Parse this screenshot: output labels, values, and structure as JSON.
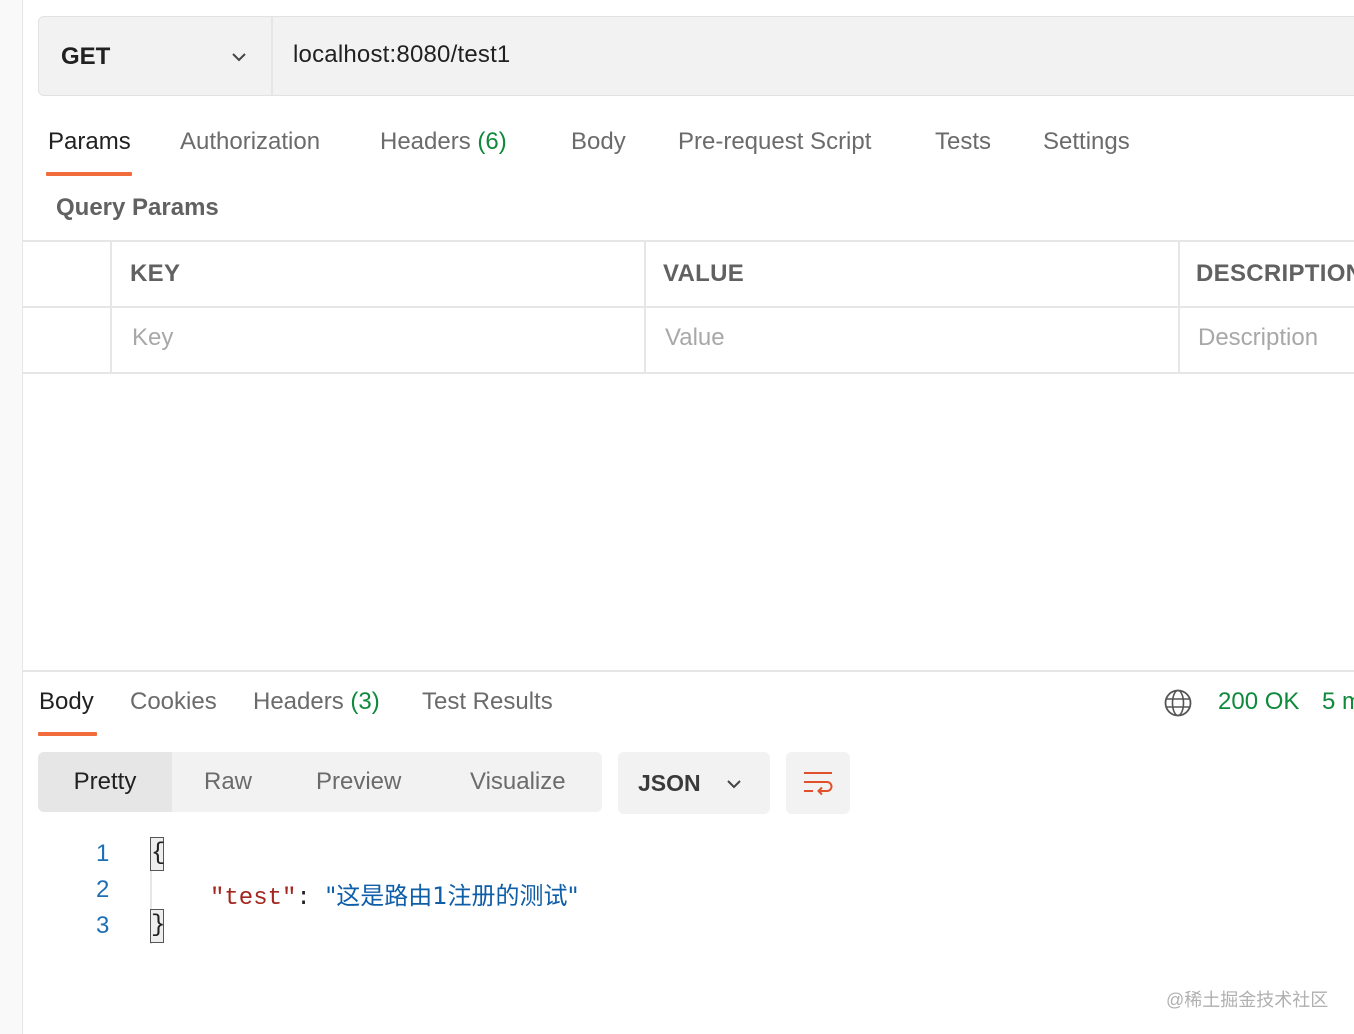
{
  "request": {
    "method": "GET",
    "url": "localhost:8080/test1"
  },
  "request_tabs": [
    {
      "label": "Params",
      "count": ""
    },
    {
      "label": "Authorization",
      "count": ""
    },
    {
      "label": "Headers",
      "count": "(6)"
    },
    {
      "label": "Body",
      "count": ""
    },
    {
      "label": "Pre-request Script",
      "count": ""
    },
    {
      "label": "Tests",
      "count": ""
    },
    {
      "label": "Settings",
      "count": ""
    }
  ],
  "params": {
    "section_title": "Query Params",
    "columns": [
      "KEY",
      "VALUE",
      "DESCRIPTION"
    ],
    "placeholders": [
      "Key",
      "Value",
      "Description"
    ]
  },
  "response_tabs": [
    {
      "label": "Body",
      "count": ""
    },
    {
      "label": "Cookies",
      "count": ""
    },
    {
      "label": "Headers",
      "count": "(3)"
    },
    {
      "label": "Test Results",
      "count": ""
    }
  ],
  "response_status": {
    "status": "200 OK",
    "time": "5 m"
  },
  "view_modes": [
    "Pretty",
    "Raw",
    "Preview",
    "Visualize"
  ],
  "format": "JSON",
  "code": {
    "line_numbers": [
      "1",
      "2",
      "3"
    ],
    "open_brace": "{",
    "close_brace": "}",
    "key": "\"test\"",
    "colon": ": ",
    "value": "\"这是路由1注册的测试\""
  },
  "watermark": "@稀土掘金技术社区",
  "colors": {
    "accent": "#f26b3a",
    "status_green": "#0f8a3c",
    "json_key": "#a3271f",
    "json_string": "#0f5ea8"
  },
  "icons": [
    "chevron-down-icon",
    "globe-icon",
    "wrap-lines-icon"
  ]
}
